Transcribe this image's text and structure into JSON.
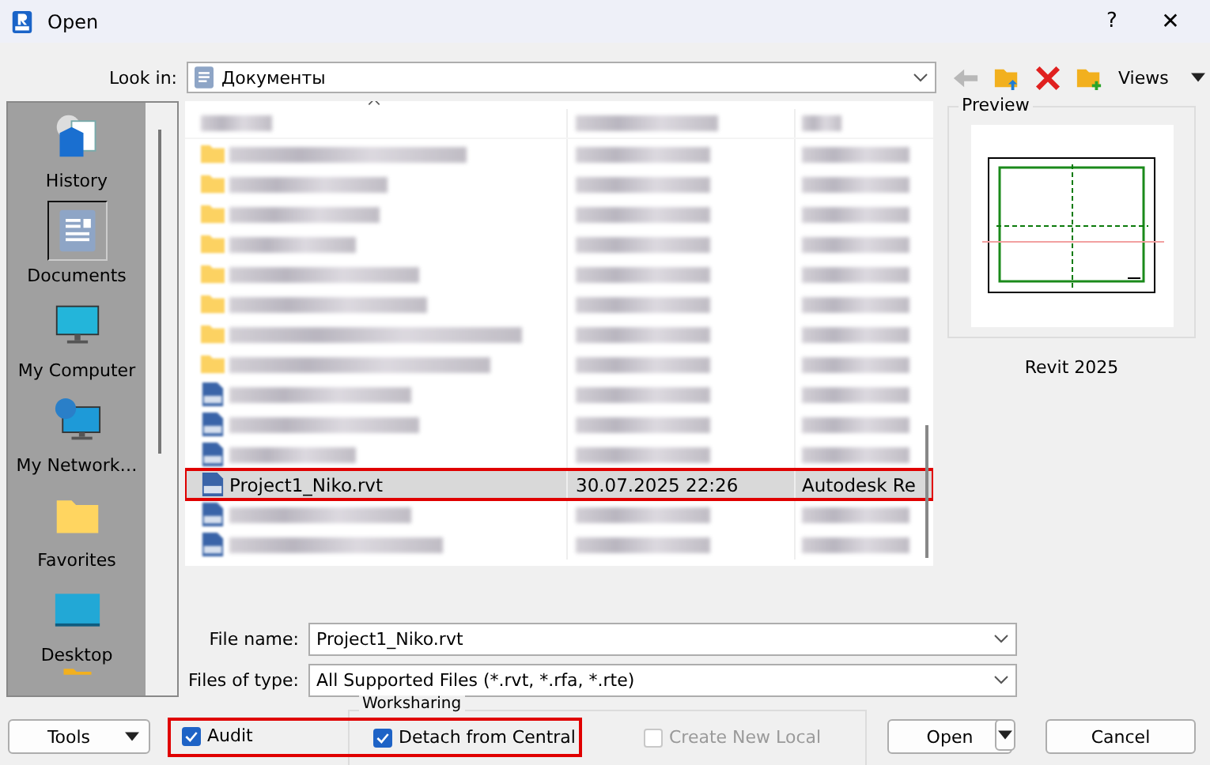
{
  "window": {
    "title": "Open",
    "help": "?",
    "close": "✕"
  },
  "look_in": {
    "label": "Look in:",
    "value": "Документы"
  },
  "toolbar": {
    "views": "Views"
  },
  "places": [
    {
      "kind": "history",
      "label": "History",
      "selected": false
    },
    {
      "kind": "documents",
      "label": "Documents",
      "selected": true
    },
    {
      "kind": "computer",
      "label": "My Computer",
      "selected": false
    },
    {
      "kind": "network",
      "label": "My Network…",
      "selected": false
    },
    {
      "kind": "favorites",
      "label": "Favorites",
      "selected": false
    },
    {
      "kind": "desktop",
      "label": "Desktop",
      "selected": false
    }
  ],
  "files": [
    {
      "kind": "folder",
      "blurred": true,
      "selected": false
    },
    {
      "kind": "folder",
      "blurred": true,
      "selected": false
    },
    {
      "kind": "folder",
      "blurred": true,
      "selected": false
    },
    {
      "kind": "folder",
      "blurred": true,
      "selected": false
    },
    {
      "kind": "folder",
      "blurred": true,
      "selected": false
    },
    {
      "kind": "folder",
      "blurred": true,
      "selected": false
    },
    {
      "kind": "folder",
      "blurred": true,
      "selected": false
    },
    {
      "kind": "folder",
      "blurred": true,
      "selected": false
    },
    {
      "kind": "rvt",
      "blurred": true,
      "selected": false
    },
    {
      "kind": "rvt",
      "blurred": true,
      "selected": false
    },
    {
      "kind": "rvt",
      "blurred": true,
      "selected": false
    },
    {
      "kind": "rvt",
      "blurred": false,
      "selected": true,
      "highlighted": true,
      "name": "Project1_Niko.rvt",
      "date": "30.07.2025 22:26",
      "type": "Autodesk Re"
    },
    {
      "kind": "rvt",
      "blurred": true,
      "selected": false
    },
    {
      "kind": "rvt",
      "blurred": true,
      "selected": false
    }
  ],
  "preview": {
    "label": "Preview",
    "version": "Revit 2025"
  },
  "file_name": {
    "label": "File name:",
    "value": "Project1_Niko.rvt"
  },
  "file_type": {
    "label": "Files of type:",
    "value": "All Supported Files (*.rvt, *.rfa, *.rte)"
  },
  "tools_button": "Tools",
  "audit": {
    "label": "Audit",
    "checked": true,
    "disabled": false
  },
  "worksharing": {
    "label": "Worksharing",
    "options": [
      {
        "label": "Detach from Central",
        "checked": true,
        "disabled": false
      },
      {
        "label": "Create New Local",
        "checked": false,
        "disabled": true
      }
    ]
  },
  "options_highlighted": true,
  "buttons": {
    "open": "Open",
    "cancel": "Cancel"
  }
}
